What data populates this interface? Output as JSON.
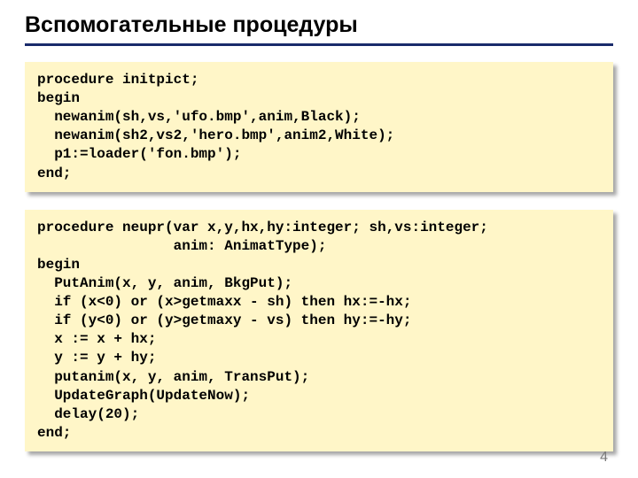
{
  "title": "Вспомогательные процедуры",
  "code1": "procedure initpict;\nbegin\n  newanim(sh,vs,'ufo.bmp',anim,Black);\n  newanim(sh2,vs2,'hero.bmp',anim2,White);\n  p1:=loader('fon.bmp');\nend;",
  "code2": "procedure neupr(var x,y,hx,hy:integer; sh,vs:integer;\n                anim: AnimatType);\nbegin\n  PutAnim(x, y, anim, BkgPut);\n  if (x<0) or (x>getmaxx - sh) then hx:=-hx;\n  if (y<0) or (y>getmaxy - vs) then hy:=-hy;\n  x := x + hx;\n  y := y + hy;\n  putanim(x, y, anim, TransPut);\n  UpdateGraph(UpdateNow);\n  delay(20);\nend;",
  "page_number": "4"
}
